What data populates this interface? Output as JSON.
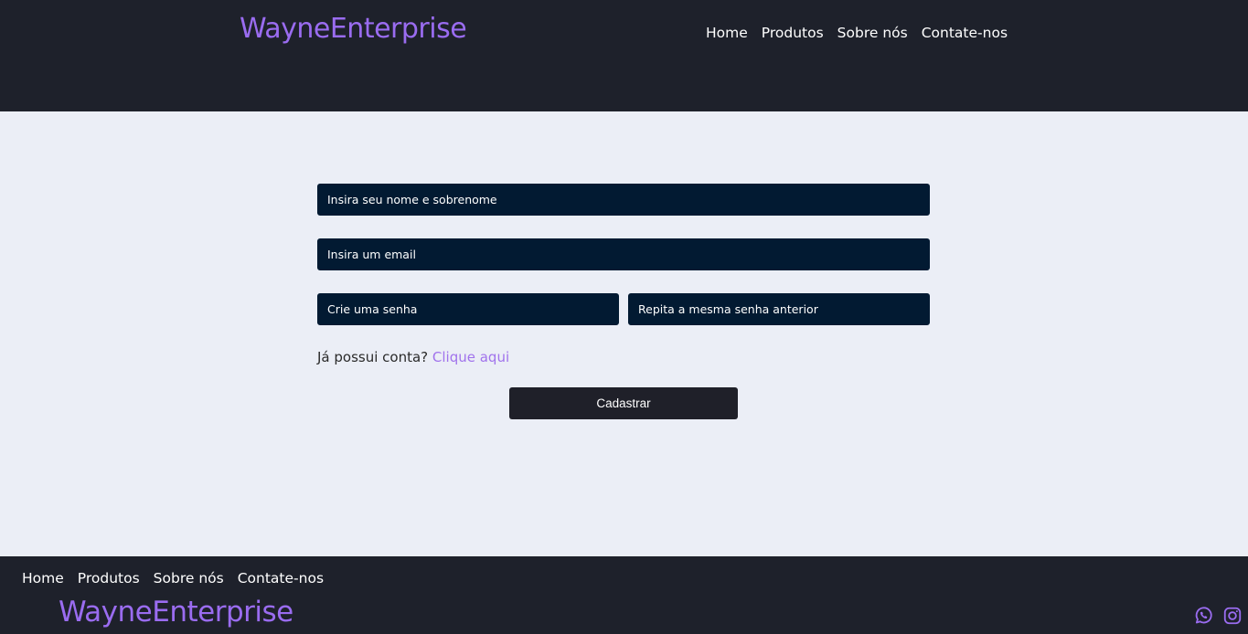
{
  "header": {
    "brand": "WayneEnterprise",
    "nav": [
      "Home",
      "Produtos",
      "Sobre nós",
      "Contate-nos"
    ]
  },
  "form": {
    "name_placeholder": "Insira seu nome e sobrenome",
    "email_placeholder": "Insira um email",
    "password_placeholder": "Crie uma senha",
    "password_repeat_placeholder": "Repita a mesma senha anterior",
    "login_prompt": "Já possui conta? ",
    "login_link": "Clique aqui",
    "submit_label": "Cadastrar"
  },
  "footer": {
    "nav": [
      "Home",
      "Produtos",
      "Sobre nós",
      "Contate-nos"
    ],
    "brand": "WayneEnterprise",
    "social": [
      "whatsapp-icon",
      "instagram-icon"
    ]
  },
  "colors": {
    "header_bg": "#1e212b",
    "page_bg": "#ebeef6",
    "brand": "#9a6cf0",
    "field_bg": "#021a32",
    "link": "#a173ec",
    "button_bg": "#1f2029"
  }
}
